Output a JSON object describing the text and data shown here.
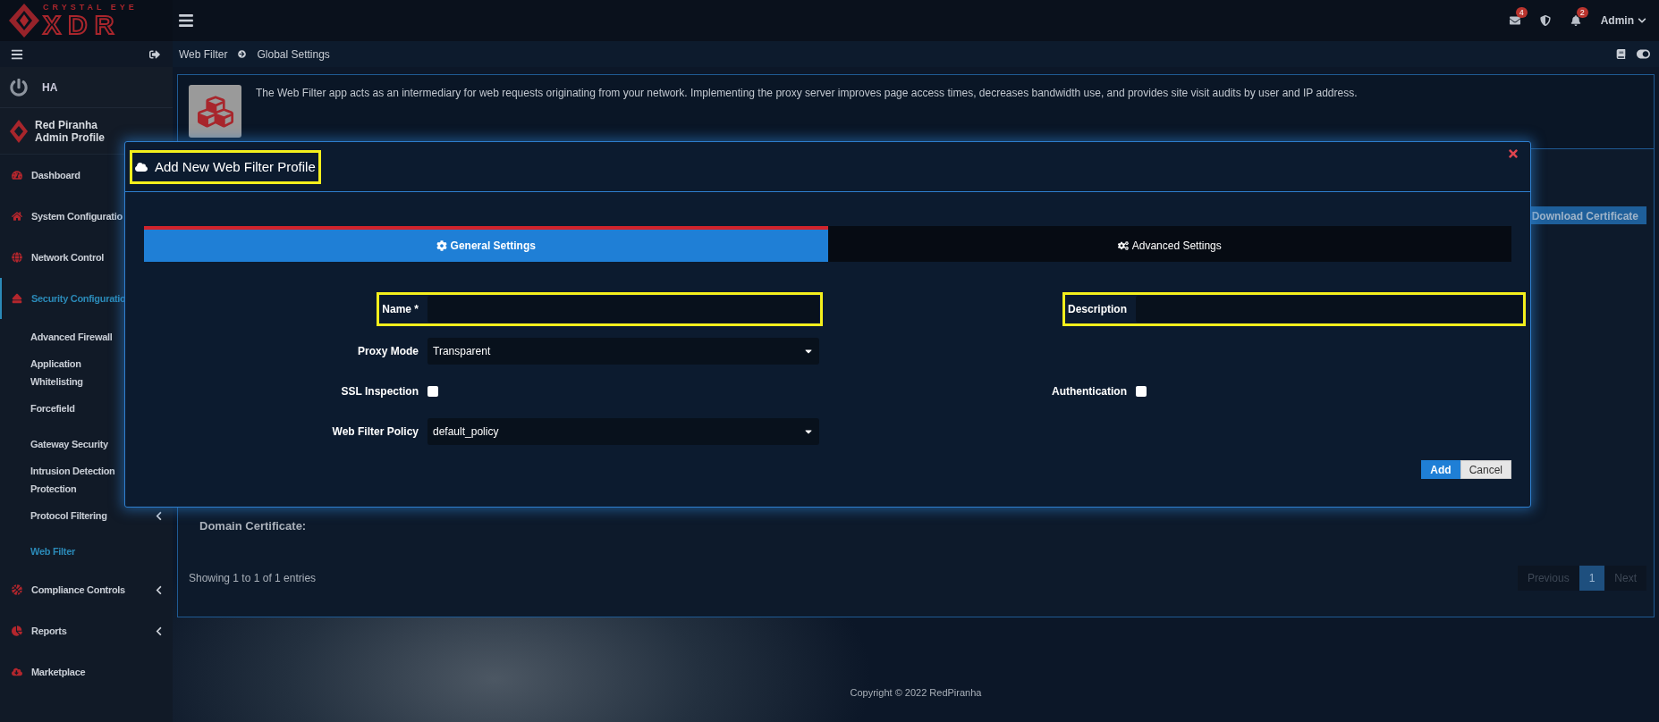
{
  "logo": {
    "tagline": "CRYSTAL EYE",
    "name": "XDR"
  },
  "header": {
    "indicators": [
      {
        "kind": "mail",
        "count": "4"
      },
      {
        "kind": "shield"
      },
      {
        "kind": "bell",
        "count": "2"
      }
    ],
    "user": "Admin"
  },
  "sidebar": {
    "ha": "HA",
    "profile": {
      "name": "Red Piranha",
      "role": "Admin Profile"
    },
    "items": [
      {
        "label": "Dashboard",
        "selected": false
      },
      {
        "label": "System Configuratio",
        "selected": false
      },
      {
        "label": "Network Control",
        "selected": false
      },
      {
        "label": "Security Configuratio",
        "selected": true,
        "children": [
          {
            "label": "Advanced Firewall",
            "selected": false
          },
          {
            "label": "Application Whitelisting",
            "selected": false
          },
          {
            "label": "Forcefield",
            "selected": false
          },
          {
            "label": "Gateway Security",
            "selected": false
          },
          {
            "label": "Intrusion Detection Protection",
            "selected": false
          },
          {
            "label": "Protocol Filtering",
            "selected": false,
            "expandable": true
          },
          {
            "label": "Web Filter",
            "selected": true,
            "expandable": false
          }
        ]
      },
      {
        "label": "Compliance Controls",
        "selected": false,
        "expandable": true
      },
      {
        "label": "Reports",
        "selected": false,
        "expandable": true
      },
      {
        "label": "Marketplace",
        "selected": false,
        "expandable": false
      }
    ]
  },
  "breadcrumb": [
    "Web Filter",
    "Global Settings"
  ],
  "info": {
    "text": "The Web Filter app acts as an intermediary for web requests originating from your network. Implementing the proxy server improves page access times, decreases bandwidth use, and provides site visit audits by user and IP address."
  },
  "panel": {
    "download_button": "Download Certificate",
    "domain_certificate": "Domain Certificate:",
    "entries": "Showing 1 to 1 of 1 entries",
    "pagination": [
      {
        "label": "Previous",
        "selected": false
      },
      {
        "label": "1",
        "selected": true
      },
      {
        "label": "Next",
        "selected": false
      }
    ]
  },
  "modal": {
    "title": "Add New Web Filter Profile",
    "title_highlighted": true,
    "tabs": [
      {
        "label": "General Settings",
        "selected": true
      },
      {
        "label": "Advanced Settings",
        "selected": false
      }
    ],
    "rows": [
      {
        "left": {
          "kind": "text",
          "label": "Name *",
          "highlighted": true
        },
        "right": {
          "kind": "text",
          "label": "Description",
          "highlighted": true
        }
      },
      {
        "left": {
          "kind": "select",
          "label": "Proxy Mode",
          "value": "Transparent",
          "highlighted": false
        }
      },
      {
        "left": {
          "kind": "checkbox",
          "label": "SSL Inspection",
          "checked": false,
          "highlighted": false
        },
        "right": {
          "kind": "checkbox",
          "label": "Authentication",
          "checked": false,
          "highlighted": false
        }
      },
      {
        "left": {
          "kind": "select",
          "label": "Web Filter Policy",
          "value": "default_policy",
          "highlighted": false
        }
      }
    ],
    "buttons": [
      {
        "label": "Add",
        "kind": "primary"
      },
      {
        "label": "Cancel",
        "kind": "secondary"
      }
    ]
  },
  "footer": "Copyright © 2022 RedPiranha"
}
